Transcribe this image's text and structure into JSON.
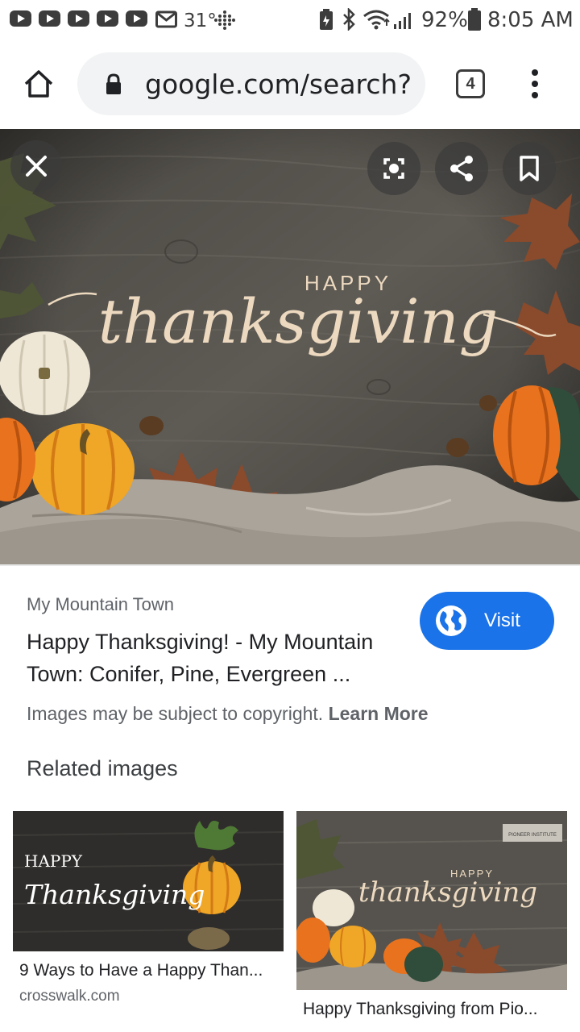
{
  "status_bar": {
    "temperature": "31°",
    "battery": "92%",
    "time": "8:05 AM",
    "icons": [
      "youtube-icon",
      "youtube-icon",
      "youtube-icon",
      "youtube-icon",
      "youtube-icon",
      "mail-icon",
      "dots-grid-icon",
      "battery-saver-icon",
      "bluetooth-icon",
      "wifi-icon",
      "signal-icon",
      "battery-icon"
    ]
  },
  "browser": {
    "url": "google.com/search?q",
    "tab_count": "4"
  },
  "hero": {
    "script_top": "HAPPY",
    "script_main": "thanksgiving"
  },
  "result": {
    "source": "My Mountain Town",
    "title": "Happy Thanksgiving! - My Mountain Town: Conifer, Pine, Evergreen ...",
    "visit_label": "Visit",
    "copyright_text": "Images may be subject to copyright.",
    "learn_more": "Learn More"
  },
  "related": {
    "heading": "Related images",
    "items": [
      {
        "image_top": "HAPPY",
        "image_main": "Thanksgiving",
        "caption": "9 Ways to Have a Happy Than...",
        "domain": "crosswalk.com"
      },
      {
        "image_top": "HAPPY",
        "image_main": "thanksgiving",
        "image_badge": "PIONEER INSTITUTE",
        "caption": "Happy Thanksgiving from Pio..."
      }
    ]
  },
  "colors": {
    "accent": "#1a73e8",
    "wood": "#55524d",
    "pumpkin_orange": "#e8721e",
    "pumpkin_yellow": "#f0a626",
    "script_cream": "#ecd9bf"
  }
}
